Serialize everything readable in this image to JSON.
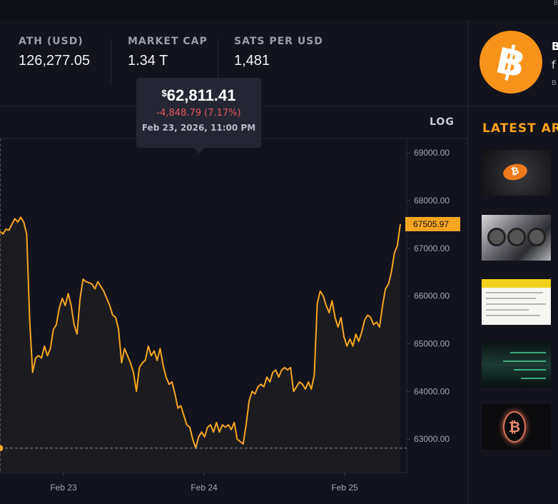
{
  "topbar": {
    "corner_text": "B"
  },
  "stats": [
    {
      "label": "ATH (USD)",
      "value": "126,277.05"
    },
    {
      "label": "MARKET CAP",
      "value": "1.34 T"
    },
    {
      "label": "SATS PER USD",
      "value": "1,481"
    }
  ],
  "chart": {
    "log_label": "LOG"
  },
  "tooltip": {
    "currency_symbol": "$",
    "price": "62,811.41",
    "change": "-4,848.79 (7.17%)",
    "date": "Feb 23, 2026, 11:00 PM"
  },
  "coin": {
    "name": "B",
    "subtitle": "f",
    "small": "B",
    "logo_glyph": "฿"
  },
  "articles": {
    "heading": "LATEST ART",
    "thumb_glyph_1": "₿",
    "thumb_glyph_5": "₿"
  },
  "colors": {
    "accent": "#f7a21b",
    "line": "#f5a623",
    "negative": "#e45a5a",
    "bg": "#12131d"
  },
  "chart_data": {
    "type": "line",
    "x_ticks": [
      "Feb 23",
      "Feb 24",
      "Feb 25"
    ],
    "y_ticks": [
      "63000.00",
      "64000.00",
      "65000.00",
      "66000.00",
      "67000.00",
      "68000.00",
      "69000.00"
    ],
    "current_value_label": "67505.97",
    "current_value": 67505.97,
    "hover_value": 62811.41,
    "ylim": [
      62300,
      69300
    ],
    "scale": "log",
    "grid": false,
    "series": [
      {
        "values": [
          67350,
          67300,
          67400,
          67380,
          67500,
          67620,
          67550,
          67650,
          67550,
          67300,
          65500,
          64400,
          64700,
          64750,
          64700,
          64950,
          64750,
          64900,
          65300,
          65400,
          65750,
          65950,
          65800,
          66050,
          65800,
          65400,
          65200,
          65950,
          66350,
          66300,
          66280,
          66250,
          66150,
          66300,
          66200,
          66100,
          65950,
          65800,
          65600,
          65550,
          65300,
          64600,
          64900,
          64750,
          64600,
          64400,
          64000,
          64500,
          64600,
          64650,
          64950,
          64750,
          64850,
          64650,
          64900,
          64550,
          64300,
          64150,
          64200,
          63950,
          63650,
          63700,
          63500,
          63300,
          63250,
          63000,
          62811,
          63050,
          63150,
          63050,
          63250,
          63300,
          63150,
          63350,
          63150,
          63300,
          63250,
          63300,
          63200,
          63350,
          63000,
          62950,
          62900,
          63300,
          63800,
          64000,
          63950,
          64100,
          64150,
          64100,
          64300,
          64200,
          64400,
          64450,
          64300,
          64450,
          64500,
          64450,
          64500,
          64000,
          64100,
          64200,
          64150,
          64050,
          64200,
          64050,
          64350,
          65850,
          66100,
          66000,
          65800,
          65650,
          65900,
          65550,
          65350,
          65550,
          65150,
          64950,
          65100,
          64950,
          65200,
          65050,
          65250,
          65500,
          65600,
          65550,
          65400,
          65450,
          65350,
          65800,
          66150,
          66250,
          66500,
          66900,
          67050,
          67505.97
        ]
      }
    ]
  }
}
